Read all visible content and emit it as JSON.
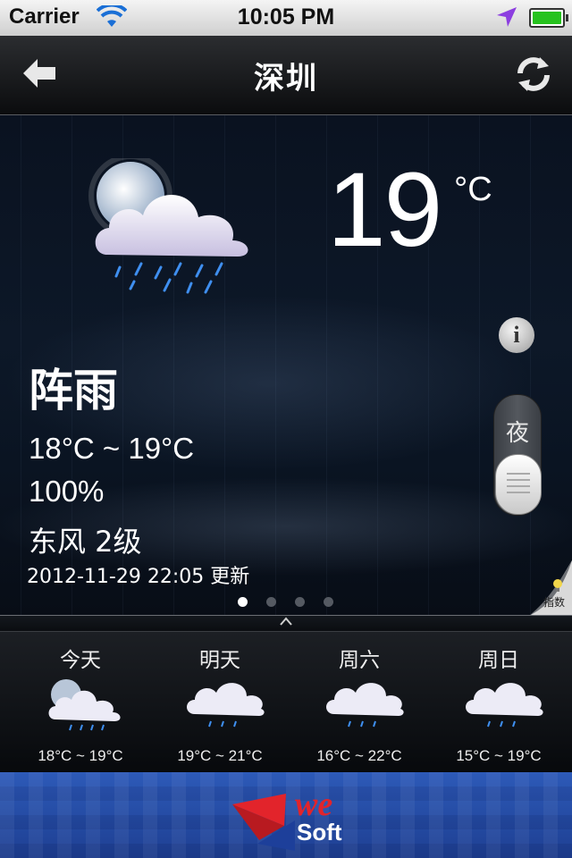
{
  "status_bar": {
    "carrier": "Carrier",
    "time": "10:05 PM",
    "icons": [
      "wifi-icon",
      "location-arrow-icon",
      "battery-icon"
    ],
    "battery_level": 1.0
  },
  "nav": {
    "title": "深圳",
    "back_icon": "back-arrow-icon",
    "refresh_icon": "refresh-icon"
  },
  "current": {
    "temperature": "19",
    "unit": "°C",
    "condition": "阵雨",
    "temp_range": "18°C ~ 19°C",
    "humidity": "100%",
    "wind": "东风 2级",
    "updated": "2012-11-29 22:05 更新",
    "icon": "moon-cloud-rain-icon",
    "info_icon": "info-icon",
    "day_night_label": "夜",
    "index_label": "指数",
    "page_count": 4,
    "active_page": 1
  },
  "forecast": [
    {
      "day": "今天",
      "range": "18°C ~ 19°C",
      "icon": "moon-cloud-rain-icon"
    },
    {
      "day": "明天",
      "range": "19°C ~ 21°C",
      "icon": "cloud-rain-icon"
    },
    {
      "day": "周六",
      "range": "16°C ~ 22°C",
      "icon": "cloud-rain-icon"
    },
    {
      "day": "周日",
      "range": "15°C ~ 19°C",
      "icon": "cloud-rain-icon"
    }
  ],
  "banner": {
    "logo_we": "we",
    "logo_soft": "Soft"
  },
  "colors": {
    "accent": "#26c21e",
    "logo_red": "#e2242b",
    "banner_blue": "#2d5ab8"
  }
}
